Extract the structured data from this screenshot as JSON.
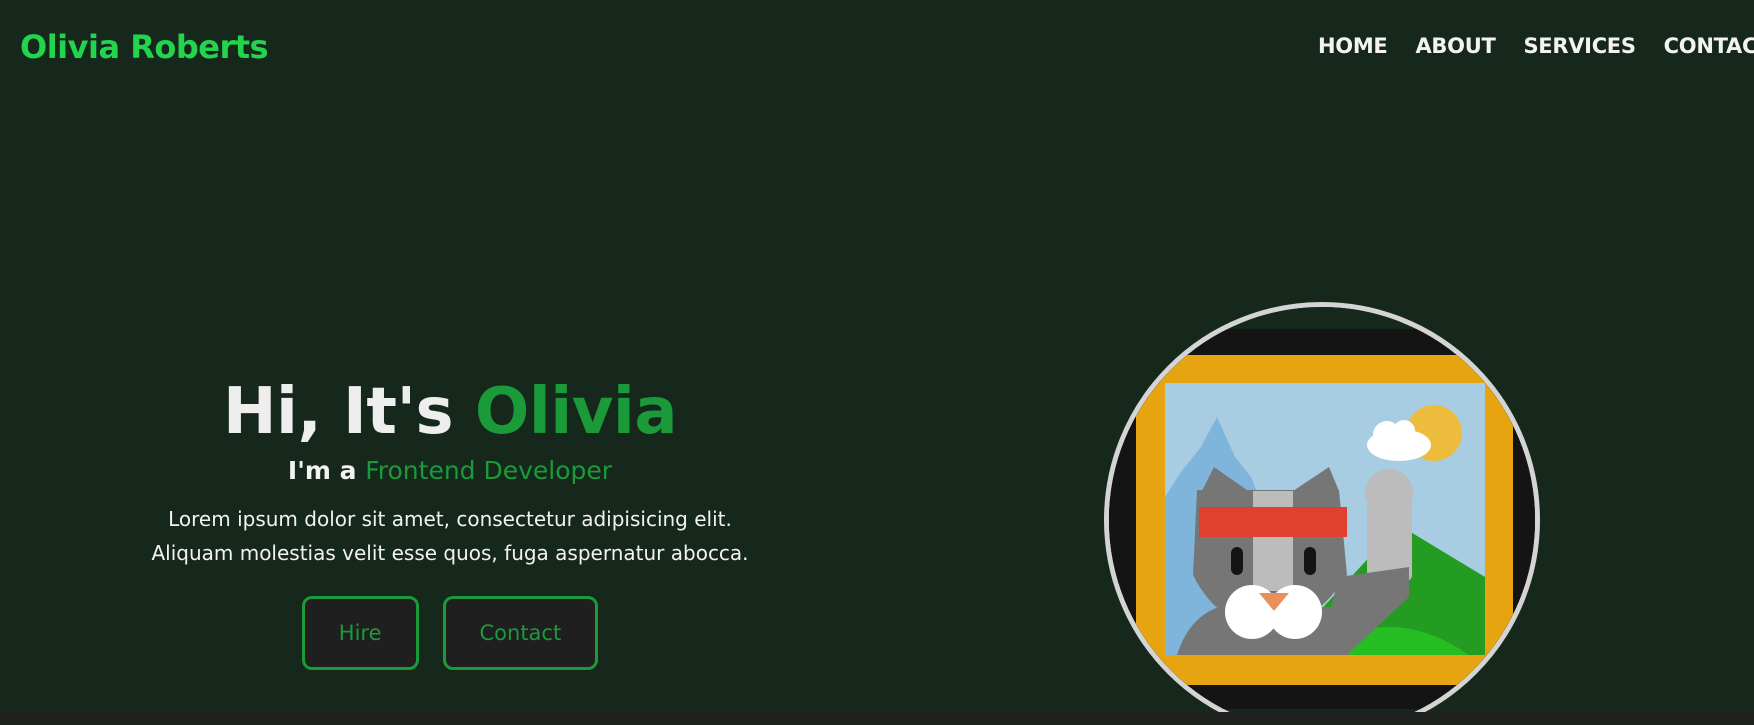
{
  "header": {
    "logo": "Olivia Roberts",
    "nav": [
      "HOME",
      "ABOUT",
      "SERVICES",
      "CONTACT"
    ]
  },
  "hero": {
    "greeting": "Hi, It's",
    "name": "Olivia",
    "role_prefix": "I'm a",
    "role": "Frontend Developer",
    "description_line1": "Lorem ipsum dolor sit amet, consectetur adipisicing elit.",
    "description_line2": "Aliquam molestias velit esse quos, fuga aspernatur abocca.",
    "hire_label": "Hire",
    "contact_label": "Contact"
  },
  "colors": {
    "background": "#16281b",
    "accent": "#1a9a38",
    "logo": "#22d44e",
    "button_bg": "#1f1f1f",
    "avatar_border": "#d4d4d4"
  },
  "avatar": {
    "icon": "ninja-cat-picture-icon"
  }
}
